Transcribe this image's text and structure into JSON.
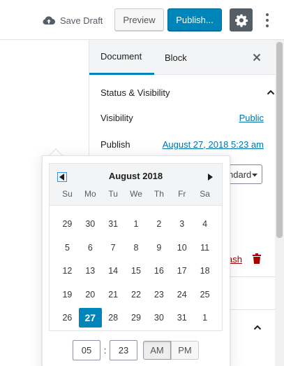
{
  "toolbar": {
    "save_draft": "Save Draft",
    "preview": "Preview",
    "publish": "Publish..."
  },
  "sidebar": {
    "tabs": [
      {
        "label": "Document",
        "active": true
      },
      {
        "label": "Block",
        "active": false
      }
    ],
    "panel_title": "Status & Visibility",
    "visibility_label": "Visibility",
    "visibility_value": "Public",
    "publish_label": "Publish",
    "publish_value": "August 27, 2018 5:23 am",
    "select_partial": "ndard",
    "trash_partial": "ash"
  },
  "datepicker": {
    "month": "August 2018",
    "weekdays": [
      "Su",
      "Mo",
      "Tu",
      "We",
      "Th",
      "Fr",
      "Sa"
    ],
    "weeks": [
      [
        "29",
        "30",
        "31",
        "1",
        "2",
        "3",
        "4"
      ],
      [
        "5",
        "6",
        "7",
        "8",
        "9",
        "10",
        "11"
      ],
      [
        "12",
        "13",
        "14",
        "15",
        "16",
        "17",
        "18"
      ],
      [
        "19",
        "20",
        "21",
        "22",
        "23",
        "24",
        "25"
      ],
      [
        "26",
        "27",
        "28",
        "29",
        "30",
        "31",
        "1"
      ]
    ],
    "selected_day": "27",
    "hours": "05",
    "minutes": "23",
    "am": "AM",
    "pm": "PM",
    "meridiem": "AM"
  },
  "colors": {
    "accent": "#0085ba",
    "link": "#0073aa",
    "danger": "#aa0000"
  }
}
